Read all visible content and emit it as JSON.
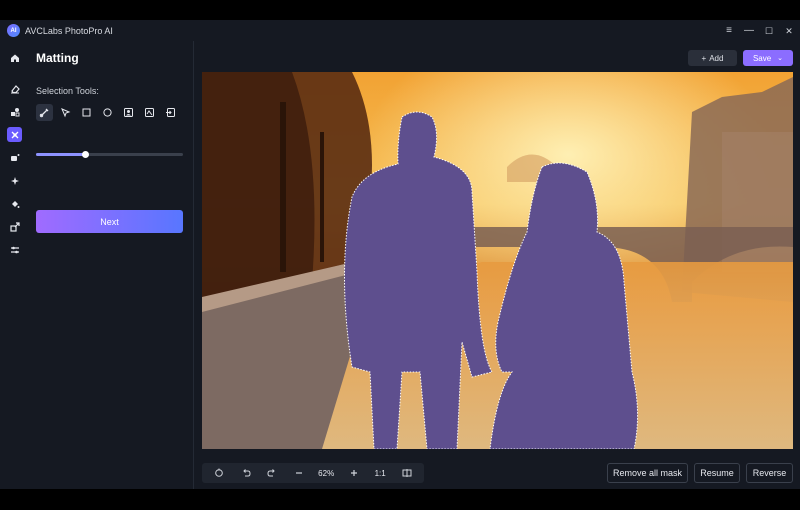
{
  "app": {
    "title": "AVCLabs PhotoPro AI",
    "logo_text": "AI",
    "accent": "#6b5cff"
  },
  "window_controls": {
    "menu": "≡",
    "minimize": "—",
    "maximize": "☐",
    "close": "✕"
  },
  "rail": {
    "items": [
      {
        "name": "home-icon",
        "active": false
      },
      {
        "name": "eraser-icon",
        "active": false
      },
      {
        "name": "shapes-icon",
        "active": false
      },
      {
        "name": "matting-icon",
        "active": true
      },
      {
        "name": "enhance-icon",
        "active": false
      },
      {
        "name": "sparkle-icon",
        "active": false
      },
      {
        "name": "fill-icon",
        "active": false
      },
      {
        "name": "crop-icon",
        "active": false
      },
      {
        "name": "adjust-icon",
        "active": false
      }
    ]
  },
  "panel": {
    "title": "Matting",
    "selection_label": "Selection Tools:",
    "tools": [
      {
        "name": "brush-tool-icon",
        "active": true
      },
      {
        "name": "pointer-tool-icon",
        "active": false
      },
      {
        "name": "rectangle-tool-icon",
        "active": false
      },
      {
        "name": "ellipse-tool-icon",
        "active": false
      },
      {
        "name": "portrait-tool-icon",
        "active": false
      },
      {
        "name": "object-tool-icon",
        "active": false
      },
      {
        "name": "import-tool-icon",
        "active": false
      }
    ],
    "brush_size_fraction": 0.33,
    "next_label": "Next"
  },
  "top_actions": {
    "add_label": "Add",
    "save_label": "Save"
  },
  "bottom": {
    "zoom": "62%",
    "one_to_one": "1:1",
    "remove_all_mask": "Remove all mask",
    "resume": "Resume",
    "reverse": "Reverse"
  }
}
